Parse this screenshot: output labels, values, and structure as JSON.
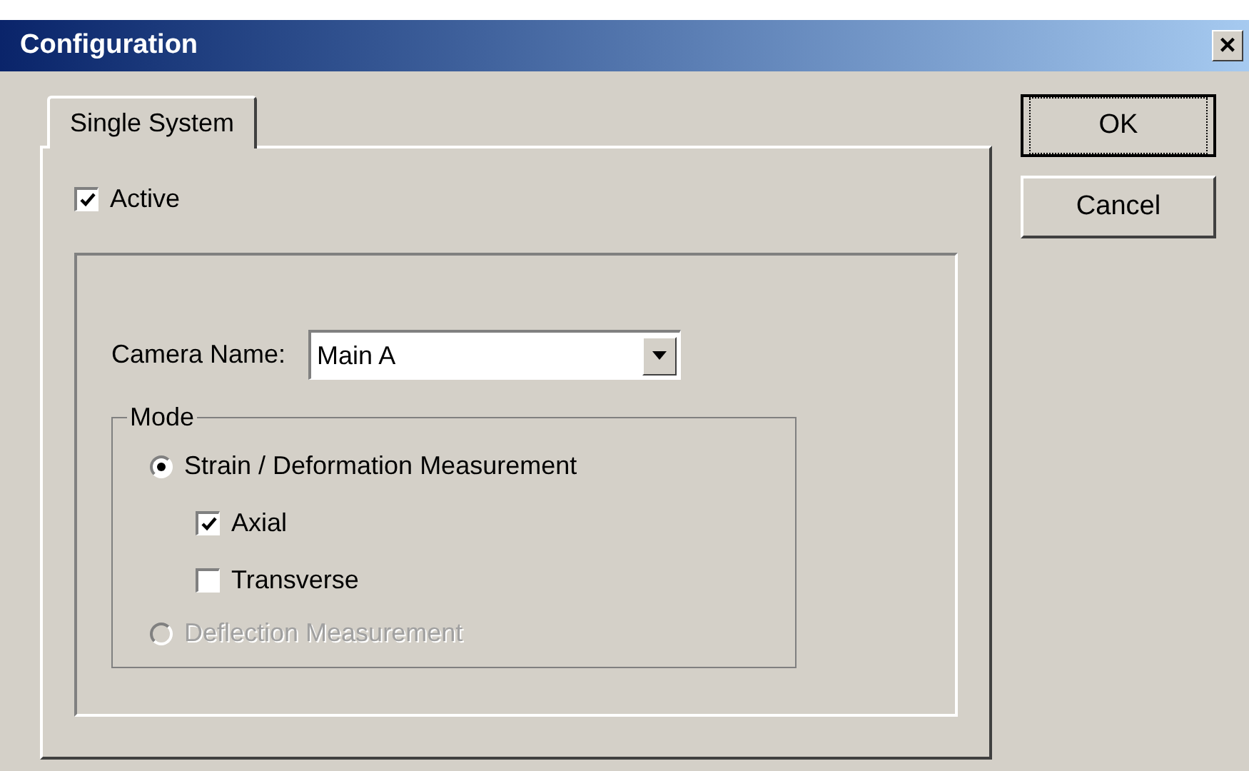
{
  "window": {
    "title": "Configuration",
    "close": "×"
  },
  "tabs": [
    {
      "label": "Single System",
      "selected": true
    }
  ],
  "active": {
    "label": "Active",
    "checked": true
  },
  "camera": {
    "label": "Camera Name:",
    "value": "Main A"
  },
  "mode": {
    "title": "Mode",
    "options": [
      {
        "kind": "radio",
        "label": "Strain / Deformation Measurement",
        "selected": true,
        "disabled": false,
        "children": [
          {
            "kind": "checkbox",
            "label": "Axial",
            "checked": true
          },
          {
            "kind": "checkbox",
            "label": "Transverse",
            "checked": false
          }
        ]
      },
      {
        "kind": "radio",
        "label": "Deflection Measurement",
        "selected": false,
        "disabled": true
      }
    ]
  },
  "buttons": [
    {
      "label": "OK",
      "default": true
    },
    {
      "label": "Cancel",
      "default": false
    }
  ]
}
